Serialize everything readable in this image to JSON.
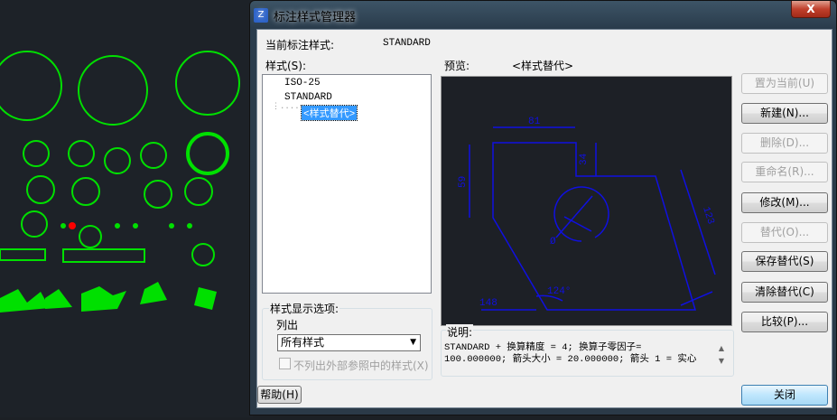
{
  "window": {
    "title": "标注样式管理器",
    "close_label": "X"
  },
  "current_style": {
    "label": "当前标注样式:",
    "value": "STANDARD"
  },
  "styles": {
    "label": "样式(S):",
    "items": [
      "ISO-25",
      "STANDARD",
      "<样式替代>"
    ]
  },
  "preview": {
    "label": "预览:",
    "name": "<样式替代>",
    "dims": [
      "81",
      "34",
      "59",
      "123",
      "148",
      "124°",
      "Ø"
    ]
  },
  "buttons": [
    {
      "label": "置为当前(U)",
      "enabled": false
    },
    {
      "label": "新建(N)...",
      "enabled": true
    },
    {
      "label": "删除(D)...",
      "enabled": false
    },
    {
      "label": "重命名(R)...",
      "enabled": false
    },
    {
      "label": "修改(M)...",
      "enabled": true
    },
    {
      "label": "替代(O)...",
      "enabled": false
    },
    {
      "label": "保存替代(S)",
      "enabled": true
    },
    {
      "label": "清除替代(C)",
      "enabled": true
    },
    {
      "label": "比较(P)...",
      "enabled": true
    }
  ],
  "display_options": {
    "group_label": "样式显示选项:",
    "list_label": "列出",
    "list_value": "所有样式",
    "xref_checkbox": "不列出外部参照中的样式(X)",
    "xref_checked": false
  },
  "description": {
    "label": "说明:",
    "line1": "STANDARD + 换算精度 = 4; 换算子零因子=",
    "line2": "100.000000; 箭头大小  = 20.000000; 箭头 1 = 实心"
  },
  "footer": {
    "help": "帮助(H)",
    "close": "关闭"
  },
  "colors": {
    "cad_symbols": "#00ff00",
    "preview_lines": "#0000e0",
    "selection": "#3399ff"
  }
}
